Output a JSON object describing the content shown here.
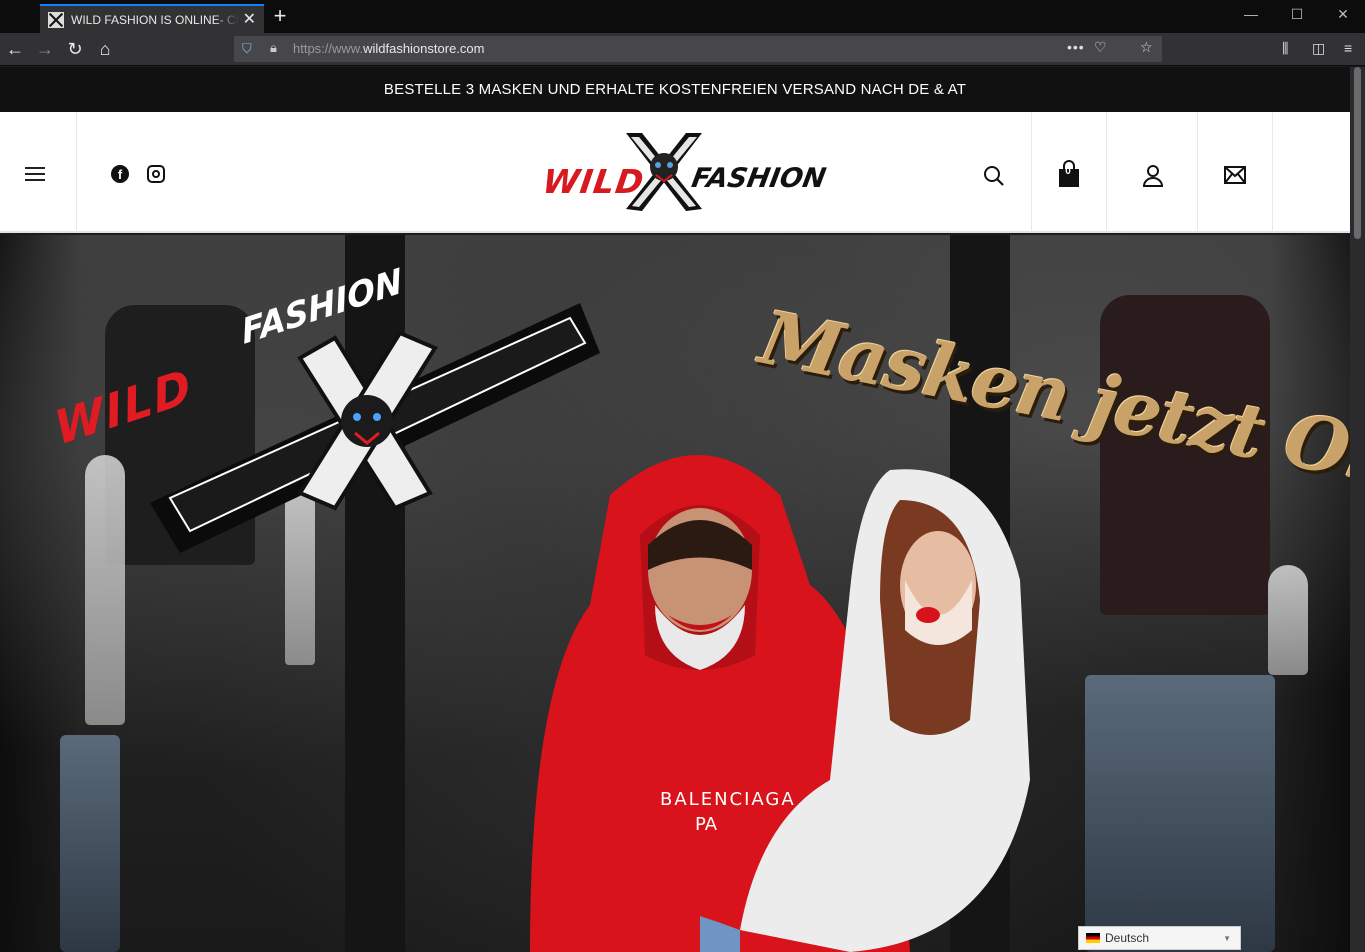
{
  "browser": {
    "tab_title": "WILD FASHION IS ONLINE- CHECK",
    "url_prefix": "https://www.",
    "url_host": "wildfashionstore.com"
  },
  "announcement": "BESTELLE 3 MASKEN UND ERHALTE KOSTENFREIEN VERSAND NACH DE & AT",
  "header": {
    "logo_left": "WILD",
    "logo_right": "FASHION",
    "cart_count": "0"
  },
  "hero": {
    "badge_left": "WILD",
    "badge_right": "FASHION",
    "headline": "Masken jetzt Online"
  },
  "language": {
    "selected": "Deutsch"
  },
  "colors": {
    "accent_red": "#d71920",
    "gold": "#c9a26a",
    "announcement_bg": "#111111"
  }
}
